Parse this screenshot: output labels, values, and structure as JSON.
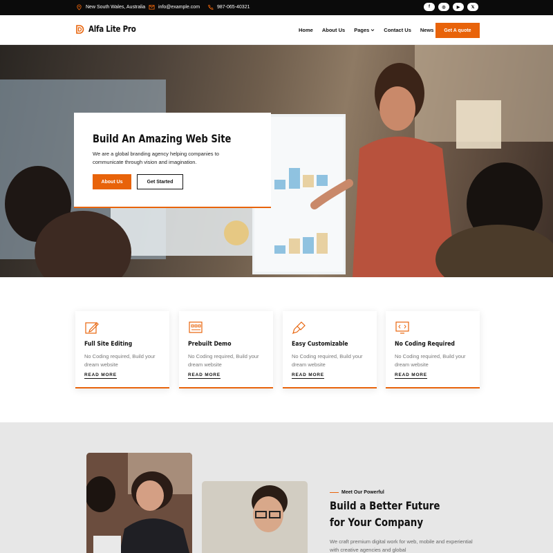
{
  "topbar": {
    "location": "New South Wales, Australia",
    "email": "info@example.com",
    "phone": "987-065-40321",
    "socials": [
      {
        "icon": "facebook-icon",
        "glyph": "f"
      },
      {
        "icon": "instagram-icon",
        "glyph": "◎"
      },
      {
        "icon": "youtube-icon",
        "glyph": "▶"
      },
      {
        "icon": "x-twitter-icon",
        "glyph": "𝕏"
      }
    ]
  },
  "header": {
    "brand": "Alfa Lite Pro",
    "nav": [
      "Home",
      "About Us",
      "Pages",
      "Contact Us",
      "News"
    ],
    "quote_label": "Get A quote"
  },
  "hero": {
    "title": "Build An Amazing Web Site",
    "text": "We are a global branding agency helping companies to communicate through vision and imagination.",
    "about_label": "About Us",
    "start_label": "Get Started"
  },
  "features": [
    {
      "title": "Full Site Editing",
      "desc": "No Coding required, Build your dream website",
      "link": "READ MORE",
      "icon": "edit-icon"
    },
    {
      "title": "Prebuilt Demo",
      "desc": "No Coding required, Build your dream website",
      "link": "READ MORE",
      "icon": "layout-icon"
    },
    {
      "title": "Easy Customizable",
      "desc": "No Coding required, Build your dream website",
      "link": "READ MORE",
      "icon": "brush-icon"
    },
    {
      "title": "No Coding Required",
      "desc": "No Coding required, Build your dream website",
      "link": "READ MORE",
      "icon": "monitor-code-icon"
    }
  ],
  "about": {
    "eyebrow": "Meet Our Powerful",
    "title_line1": "Build a Better Future",
    "title_line2": "for Your Company",
    "text": "We craft premium digital work for web, mobile and experiential with creative agencies and global"
  },
  "colors": {
    "accent": "#e8630a",
    "topbar": "#0b0b0b",
    "section_bg": "#e7e7e7"
  }
}
